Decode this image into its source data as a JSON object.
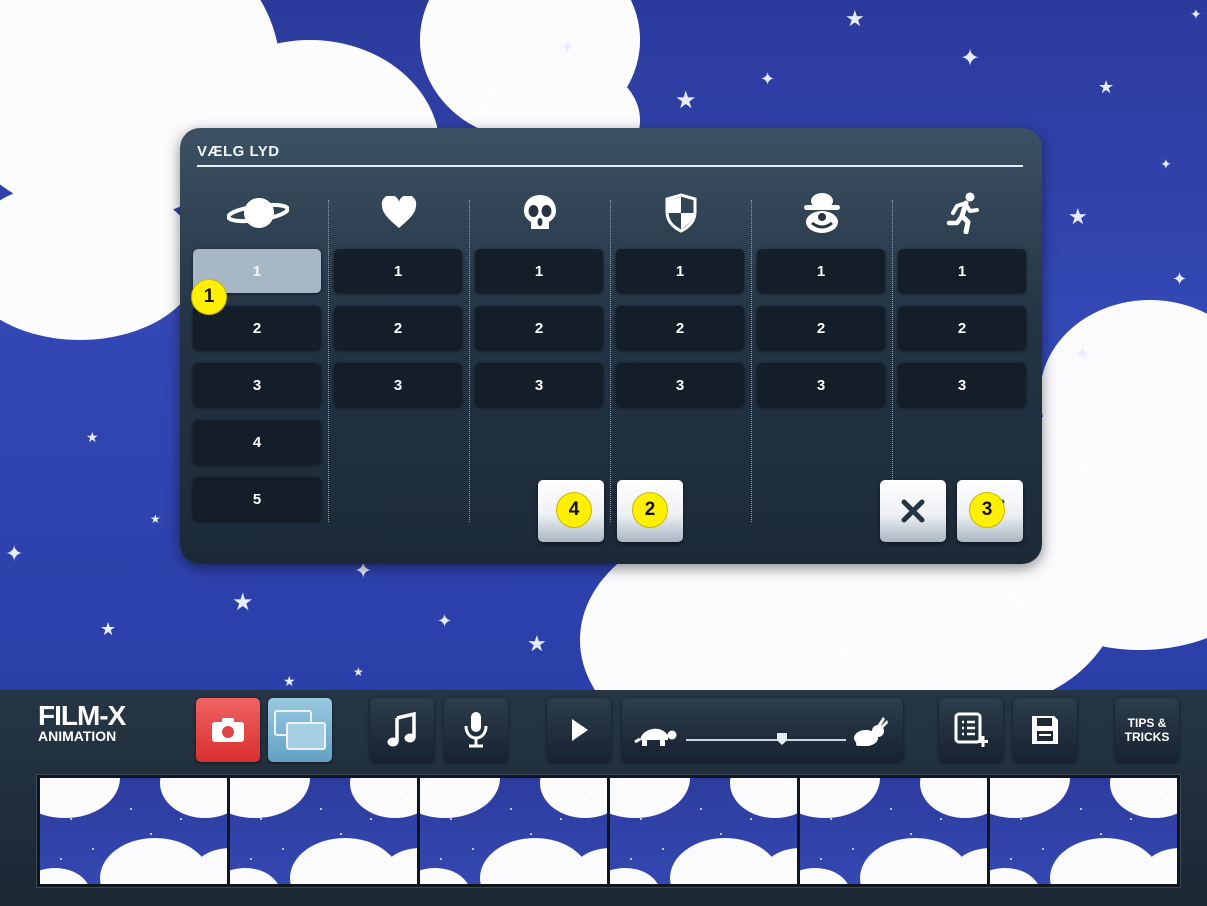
{
  "app": {
    "logo_main": "FILM-X",
    "logo_sub": "ANIMATION"
  },
  "dialog": {
    "title": "VÆLG LYD",
    "categories": [
      {
        "icon": "planet-icon",
        "buttons": [
          "1",
          "2",
          "3",
          "4",
          "5"
        ],
        "selected": "1"
      },
      {
        "icon": "heart-icon",
        "buttons": [
          "1",
          "2",
          "3"
        ]
      },
      {
        "icon": "skull-icon",
        "buttons": [
          "1",
          "2",
          "3"
        ]
      },
      {
        "icon": "shield-icon",
        "buttons": [
          "1",
          "2",
          "3"
        ]
      },
      {
        "icon": "clown-icon",
        "buttons": [
          "1",
          "2",
          "3"
        ]
      },
      {
        "icon": "running-man-icon",
        "buttons": [
          "1",
          "2",
          "3"
        ]
      }
    ]
  },
  "callouts": [
    "1",
    "2",
    "3",
    "4"
  ],
  "toolbar": {
    "tips_line1": "TIPS &",
    "tips_line2": "TRICKS",
    "speed_value_fraction": 0.6
  },
  "colors": {
    "accent_red": "#e04545",
    "accent_blue": "#7db6d4",
    "callout_yellow": "#ffef00"
  }
}
